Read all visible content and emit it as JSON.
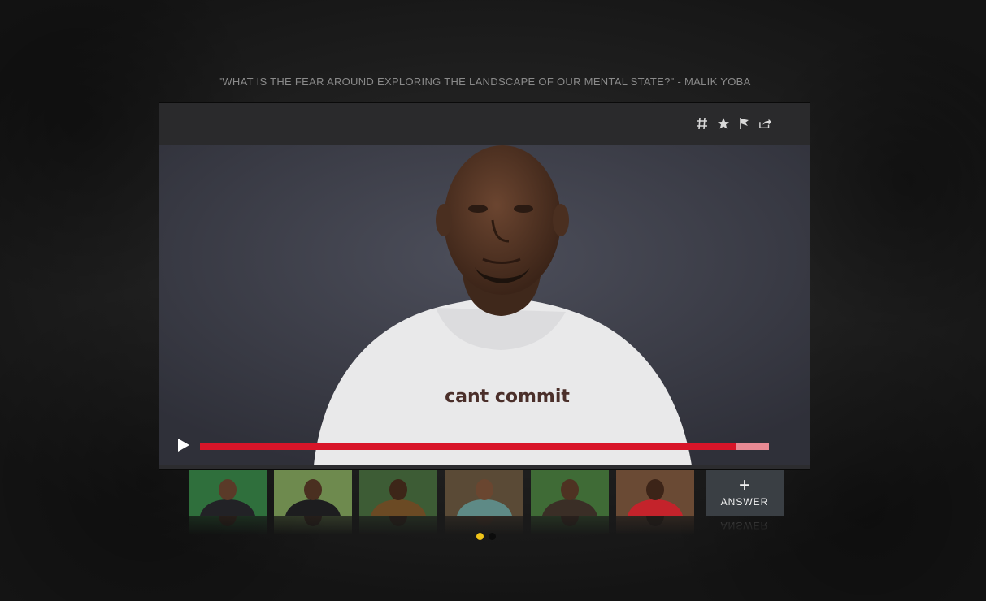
{
  "quote": {
    "text": "\"WHAT IS THE FEAR AROUND EXPLORING THE LANDSCAPE OF OUR MENTAL STATE?\" - MALIK YOBA"
  },
  "toolbar": {
    "icons": [
      "hashtag-icon",
      "star-icon",
      "flag-icon",
      "share-icon"
    ]
  },
  "video": {
    "shirt_text": "cant commit",
    "progress": 0.943
  },
  "thumbnails": [
    {
      "name": "thumbnail-1",
      "bg": "#2f6f3c",
      "shirt": "#222226",
      "skin": "#5a3a28"
    },
    {
      "name": "thumbnail-2",
      "bg": "#6e8a4e",
      "shirt": "#1d1d1f",
      "skin": "#4a2f20"
    },
    {
      "name": "thumbnail-3",
      "bg": "#3d5c35",
      "shirt": "#6b4a24",
      "skin": "#3d2618"
    },
    {
      "name": "thumbnail-4",
      "bg": "#5a4a36",
      "shirt": "#5e8a86",
      "skin": "#6a4630"
    },
    {
      "name": "thumbnail-5",
      "bg": "#3f6b36",
      "shirt": "#3a2e26",
      "skin": "#4e3222"
    },
    {
      "name": "thumbnail-6",
      "bg": "#6a4a34",
      "shirt": "#c4232b",
      "skin": "#3c2418"
    }
  ],
  "answer": {
    "plus": "+",
    "label": "ANSWER"
  },
  "pagination": {
    "current": 1,
    "total": 2
  },
  "colors": {
    "accent": "#d81529",
    "progress_buffer": "#e88a94",
    "dot_active": "#f0c419"
  }
}
